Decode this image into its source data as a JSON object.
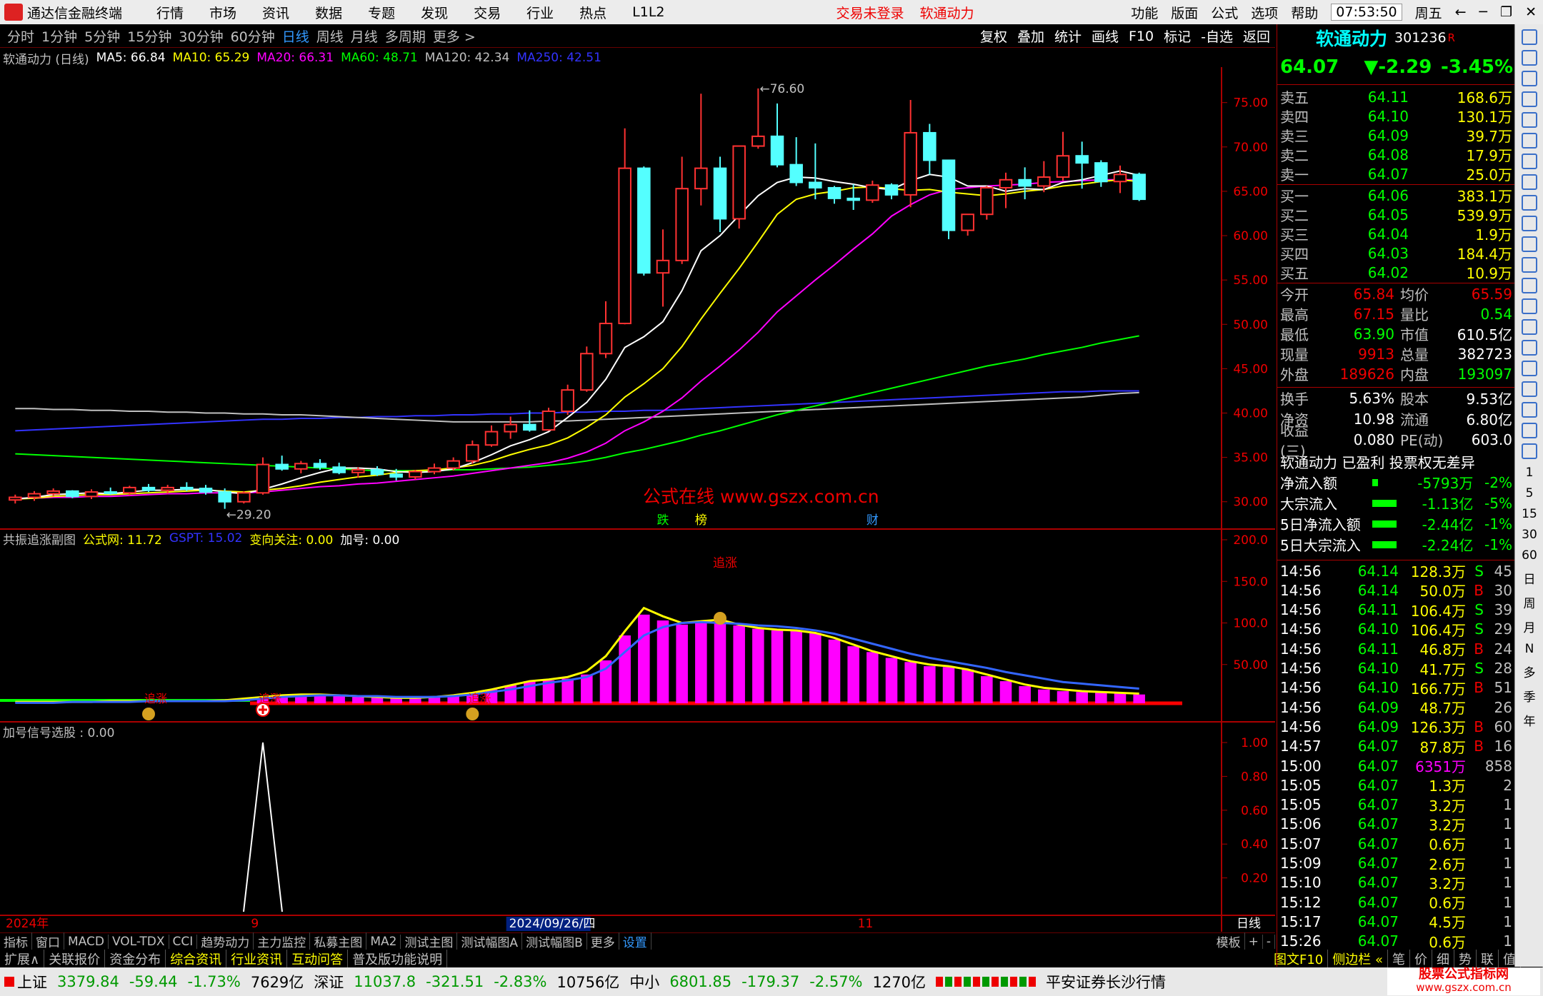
{
  "app": {
    "title": "通达信金融终端",
    "menus": [
      "行情",
      "市场",
      "资讯",
      "数据",
      "专题",
      "发现",
      "交易",
      "行业",
      "热点",
      "L1L2"
    ],
    "warn1": "交易未登录",
    "warn2": "软通动力",
    "rmenus": [
      "功能",
      "版面",
      "公式",
      "选项",
      "帮助"
    ],
    "clock": "07:53:50",
    "weekday": "周五"
  },
  "periods": {
    "items": [
      "分时",
      "1分钟",
      "5分钟",
      "15分钟",
      "30分钟",
      "60分钟",
      "日线",
      "周线",
      "月线",
      "多周期",
      "更多 >"
    ],
    "active": 6,
    "tools": [
      "复权",
      "叠加",
      "统计",
      "画线",
      "F10",
      "标记",
      "-自选",
      "返回"
    ]
  },
  "main": {
    "stock_label": "软通动力 (日线)",
    "ma": [
      {
        "name": "MA5: 66.84",
        "color": "#ffffff"
      },
      {
        "name": "MA10: 65.29",
        "color": "#ffff00"
      },
      {
        "name": "MA20: 66.31",
        "color": "#ff00ff"
      },
      {
        "name": "MA60: 48.71",
        "color": "#00ff00"
      },
      {
        "name": "MA120: 42.34",
        "color": "#c0c0c0"
      },
      {
        "name": "MA250: 42.51",
        "color": "#3333ff"
      }
    ],
    "high_mark": "76.60",
    "low_mark": "29.20",
    "watermark": "公式在线  www.gszx.com.cn",
    "tags": [
      "跌",
      "榜",
      "财"
    ],
    "yticks": [
      "75.00",
      "70.00",
      "65.00",
      "60.00",
      "55.00",
      "50.00",
      "45.00",
      "40.00",
      "35.00",
      "30.00"
    ]
  },
  "sub1": {
    "title": "共振追涨副图",
    "items": [
      "公式网: 11.72",
      "GSPT: 15.02",
      "变向关注: 0.00",
      "加号: 0.00"
    ],
    "label_top": "追涨",
    "label_chase": "追涨",
    "yticks": [
      "200.0",
      "150.0",
      "100.0",
      "50.00"
    ]
  },
  "sub2": {
    "title": "加号信号选股 : 0.00",
    "yticks": [
      "1.00",
      "0.80",
      "0.60",
      "0.40",
      "0.20"
    ]
  },
  "dates": {
    "d1": "2024年",
    "d2": "9",
    "d3": "2024/09/26/四",
    "d4": "11",
    "period": "日线"
  },
  "tabs": [
    "指标",
    "窗口",
    "MACD",
    "VOL-TDX",
    "CCI",
    "趋势动力",
    "主力监控",
    "私募主图",
    "MA2",
    "测试主图",
    "测试幅图A",
    "测试幅图B",
    "更多",
    "设置"
  ],
  "tabs_right": [
    "模板",
    "+",
    "-"
  ],
  "ext": [
    "扩展∧",
    "关联报价",
    "资金分布",
    "综合资讯",
    "行业资讯",
    "互动问答",
    "普及版功能说明"
  ],
  "ext_right": [
    "图文F10",
    "侧边栏 «",
    "笔",
    "价",
    "细",
    "势",
    "联",
    "值",
    "主"
  ],
  "quote": {
    "name": "软通动力",
    "code": "301236",
    "badge": "R",
    "price": "64.07",
    "change": "▼-2.29",
    "pct": "-3.45%"
  },
  "book": {
    "asks": [
      [
        "卖五",
        "64.11",
        "168.6万"
      ],
      [
        "卖四",
        "64.10",
        "130.1万"
      ],
      [
        "卖三",
        "64.09",
        "39.7万"
      ],
      [
        "卖二",
        "64.08",
        "17.9万"
      ],
      [
        "卖一",
        "64.07",
        "25.0万"
      ]
    ],
    "bids": [
      [
        "买一",
        "64.06",
        "383.1万"
      ],
      [
        "买二",
        "64.05",
        "539.9万"
      ],
      [
        "买三",
        "64.04",
        "1.9万"
      ],
      [
        "买四",
        "64.03",
        "184.4万"
      ],
      [
        "买五",
        "64.02",
        "10.9万"
      ]
    ]
  },
  "stats": [
    [
      "今开",
      "65.84",
      "均价",
      "65.59"
    ],
    [
      "最高",
      "67.15",
      "量比",
      "0.54"
    ],
    [
      "最低",
      "63.90",
      "市值",
      "610.5亿"
    ],
    [
      "现量",
      "9913",
      "总量",
      "382723"
    ],
    [
      "外盘",
      "189626",
      "内盘",
      "193097"
    ]
  ],
  "stats2": [
    [
      "换手",
      "5.63%",
      "股本",
      "9.53亿"
    ],
    [
      "净资",
      "10.98",
      "流通",
      "6.80亿"
    ],
    [
      "收益(三)",
      "0.080",
      "PE(动)",
      "603.0"
    ]
  ],
  "info": "软通动力 已盈利 投票权无差异",
  "flows": [
    [
      "净流入额",
      "-5793万",
      "-2%"
    ],
    [
      "大宗流入",
      "-1.13亿",
      "-5%"
    ],
    [
      "5日净流入额",
      "-2.44亿",
      "-1%"
    ],
    [
      "5日大宗流入",
      "-2.24亿",
      "-1%"
    ]
  ],
  "ticks": [
    [
      "14:56",
      "64.14",
      "128.3万",
      "S",
      "45"
    ],
    [
      "14:56",
      "64.14",
      "50.0万",
      "B",
      "30"
    ],
    [
      "14:56",
      "64.11",
      "106.4万",
      "S",
      "39"
    ],
    [
      "14:56",
      "64.10",
      "106.4万",
      "S",
      "29"
    ],
    [
      "14:56",
      "64.11",
      "46.8万",
      "B",
      "24"
    ],
    [
      "14:56",
      "64.10",
      "41.7万",
      "S",
      "28"
    ],
    [
      "14:56",
      "64.10",
      "166.7万",
      "B",
      "51"
    ],
    [
      "14:56",
      "64.09",
      "48.7万",
      "",
      "26"
    ],
    [
      "14:56",
      "64.09",
      "126.3万",
      "B",
      "60"
    ],
    [
      "14:57",
      "64.07",
      "87.8万",
      "B",
      "16"
    ],
    [
      "15:00",
      "64.07",
      "6351万",
      "",
      "858"
    ],
    [
      "15:05",
      "64.07",
      "1.3万",
      "",
      "2"
    ],
    [
      "15:05",
      "64.07",
      "3.2万",
      "",
      "1"
    ],
    [
      "15:06",
      "64.07",
      "3.2万",
      "",
      "1"
    ],
    [
      "15:07",
      "64.07",
      "0.6万",
      "",
      "1"
    ],
    [
      "15:09",
      "64.07",
      "2.6万",
      "",
      "1"
    ],
    [
      "15:10",
      "64.07",
      "3.2万",
      "",
      "1"
    ],
    [
      "15:12",
      "64.07",
      "0.6万",
      "",
      "1"
    ],
    [
      "15:17",
      "64.07",
      "4.5万",
      "",
      "1"
    ],
    [
      "15:26",
      "64.07",
      "0.6万",
      "",
      "1"
    ]
  ],
  "sidebar": [
    "1",
    "5",
    "15",
    "30",
    "60",
    "日",
    "周",
    "月",
    "N",
    "多",
    "季",
    "年"
  ],
  "status": {
    "sh": "上证",
    "sh_v": "3379.84",
    "sh_c": "-59.44",
    "sh_p": "-1.73%",
    "sh_a": "7629亿",
    "sz": "深证",
    "sz_v": "11037.8",
    "sz_c": "-321.51",
    "sz_p": "-2.83%",
    "sz_a": "10756亿",
    "zx": "中小",
    "zx_v": "6801.85",
    "zx_c": "-179.37",
    "zx_p": "-2.57%",
    "zx_a": "1270亿",
    "broker": "平安证券长沙行情",
    "site": "股票公式指标网",
    "site_url": "www.gszx.com.cn"
  },
  "chart_data": {
    "type": "candlestick",
    "ohlc": [
      [
        30.2,
        30.8,
        29.8,
        30.5
      ],
      [
        30.5,
        31.2,
        30.1,
        30.9
      ],
      [
        30.9,
        31.5,
        30.6,
        31.2
      ],
      [
        31.2,
        31.3,
        30.4,
        30.6
      ],
      [
        30.6,
        31.4,
        30.3,
        31.1
      ],
      [
        31.1,
        31.6,
        30.8,
        31.0
      ],
      [
        31.0,
        31.8,
        30.7,
        31.6
      ],
      [
        31.6,
        32.0,
        31.1,
        31.3
      ],
      [
        31.3,
        31.9,
        30.9,
        31.6
      ],
      [
        31.6,
        32.2,
        31.2,
        31.5
      ],
      [
        31.5,
        31.9,
        30.8,
        31.1
      ],
      [
        31.1,
        31.5,
        29.2,
        30.0
      ],
      [
        30.0,
        31.2,
        29.8,
        31.0
      ],
      [
        31.0,
        35.0,
        30.8,
        34.2
      ],
      [
        34.2,
        35.2,
        33.5,
        33.7
      ],
      [
        33.7,
        34.6,
        33.2,
        34.3
      ],
      [
        34.3,
        34.8,
        33.6,
        33.9
      ],
      [
        33.9,
        34.4,
        33.1,
        33.3
      ],
      [
        33.3,
        33.9,
        32.7,
        33.6
      ],
      [
        33.6,
        34.0,
        32.9,
        33.1
      ],
      [
        33.1,
        33.7,
        32.4,
        32.8
      ],
      [
        32.8,
        33.6,
        32.5,
        33.4
      ],
      [
        33.4,
        34.3,
        33.1,
        33.8
      ],
      [
        33.8,
        35.0,
        33.5,
        34.6
      ],
      [
        34.6,
        36.9,
        34.3,
        36.4
      ],
      [
        36.4,
        38.6,
        36.2,
        37.9
      ],
      [
        37.9,
        39.6,
        37.1,
        38.7
      ],
      [
        38.7,
        40.3,
        37.9,
        38.1
      ],
      [
        38.1,
        40.6,
        38.0,
        40.2
      ],
      [
        40.2,
        43.2,
        39.8,
        42.6
      ],
      [
        42.6,
        47.5,
        42.4,
        46.7
      ],
      [
        46.7,
        52.6,
        46.2,
        50.1
      ],
      [
        50.1,
        72.1,
        50.0,
        67.6
      ],
      [
        67.6,
        67.8,
        55.5,
        55.8
      ],
      [
        55.8,
        60.7,
        52.0,
        57.2
      ],
      [
        57.2,
        68.9,
        56.8,
        65.3
      ],
      [
        65.3,
        76.0,
        63.4,
        67.6
      ],
      [
        67.6,
        68.9,
        60.4,
        61.9
      ],
      [
        61.9,
        69.2,
        60.8,
        70.1
      ],
      [
        70.1,
        76.6,
        69.8,
        71.2
      ],
      [
        71.2,
        74.9,
        67.7,
        68.0
      ],
      [
        68.0,
        71.1,
        65.6,
        66.0
      ],
      [
        66.0,
        70.4,
        64.1,
        65.4
      ],
      [
        65.4,
        65.6,
        63.6,
        64.2
      ],
      [
        64.2,
        65.8,
        62.9,
        64.0
      ],
      [
        64.0,
        66.2,
        63.7,
        65.7
      ],
      [
        65.7,
        65.9,
        64.1,
        64.6
      ],
      [
        64.6,
        75.3,
        63.2,
        71.6
      ],
      [
        71.6,
        72.6,
        66.9,
        68.5
      ],
      [
        68.5,
        67.3,
        59.6,
        60.6
      ],
      [
        60.6,
        62.1,
        60.0,
        62.4
      ],
      [
        62.4,
        65.6,
        61.8,
        65.4
      ],
      [
        65.4,
        67.1,
        63.1,
        66.3
      ],
      [
        66.3,
        67.7,
        64.1,
        65.6
      ],
      [
        65.6,
        68.4,
        64.9,
        66.6
      ],
      [
        66.6,
        71.7,
        66.2,
        69.0
      ],
      [
        69.0,
        70.6,
        65.3,
        68.2
      ],
      [
        68.2,
        68.5,
        65.5,
        66.1
      ],
      [
        66.1,
        67.9,
        64.8,
        66.9
      ],
      [
        66.9,
        67.1,
        63.9,
        64.1
      ]
    ],
    "ma5": [
      30.3,
      30.5,
      30.8,
      30.9,
      31.0,
      30.9,
      31.1,
      31.3,
      31.3,
      31.4,
      31.4,
      31.1,
      30.9,
      31.4,
      32.0,
      32.7,
      33.3,
      33.8,
      33.8,
      33.7,
      33.4,
      33.3,
      33.4,
      33.7,
      34.4,
      35.3,
      36.3,
      37.0,
      37.9,
      39.5,
      41.2,
      43.8,
      47.4,
      48.6,
      50.3,
      53.8,
      58.3,
      60.0,
      62.3,
      64.5,
      66.0,
      66.6,
      66.5,
      66.1,
      65.8,
      65.4,
      65.2,
      66.2,
      66.9,
      66.6,
      65.6,
      65.6,
      65.0,
      65.3,
      65.2,
      66.0,
      66.3,
      66.8,
      67.3,
      66.8
    ],
    "ma10": [
      30.3,
      30.4,
      30.6,
      30.7,
      30.8,
      30.8,
      30.9,
      31.0,
      31.1,
      31.2,
      31.3,
      31.2,
      31.1,
      31.3,
      31.5,
      31.8,
      32.2,
      32.5,
      32.8,
      33.0,
      33.3,
      33.5,
      33.6,
      33.8,
      34.1,
      34.6,
      35.3,
      35.9,
      36.4,
      37.2,
      38.4,
      39.8,
      41.8,
      43.3,
      45.0,
      47.5,
      50.6,
      53.5,
      56.3,
      59.3,
      62.4,
      64.1,
      64.7,
      65.0,
      65.4,
      65.5,
      65.3,
      65.1,
      65.2,
      64.9,
      64.7,
      64.5,
      64.7,
      65.0,
      65.2,
      65.6,
      65.8,
      66.1,
      66.3,
      66.1
    ],
    "ma20": [
      30.4,
      30.4,
      30.5,
      30.5,
      30.6,
      30.6,
      30.7,
      30.8,
      30.9,
      30.9,
      31.0,
      31.0,
      31.0,
      31.1,
      31.3,
      31.5,
      31.7,
      31.8,
      32.0,
      32.1,
      32.3,
      32.5,
      32.7,
      32.9,
      33.2,
      33.5,
      33.8,
      34.1,
      34.4,
      34.9,
      35.6,
      36.6,
      38.0,
      39.0,
      40.2,
      41.7,
      43.6,
      45.3,
      47.1,
      49.1,
      51.4,
      53.2,
      55.0,
      56.7,
      58.5,
      60.2,
      62.2,
      63.5,
      64.6,
      65.2,
      65.4,
      65.6,
      65.7,
      65.8,
      66.0,
      66.1,
      66.2,
      66.3,
      66.3,
      66.3
    ],
    "ma60": [
      35.4,
      35.3,
      35.2,
      35.1,
      35.0,
      34.9,
      34.8,
      34.7,
      34.6,
      34.5,
      34.4,
      34.3,
      34.2,
      34.1,
      34.0,
      33.9,
      33.8,
      33.7,
      33.6,
      33.5,
      33.5,
      33.5,
      33.5,
      33.6,
      33.6,
      33.7,
      33.8,
      33.9,
      34.1,
      34.3,
      34.6,
      35.0,
      35.5,
      35.9,
      36.4,
      36.9,
      37.5,
      38.0,
      38.6,
      39.2,
      39.8,
      40.3,
      40.8,
      41.3,
      41.8,
      42.3,
      42.8,
      43.3,
      43.8,
      44.3,
      44.8,
      45.3,
      45.7,
      46.1,
      46.6,
      47.0,
      47.4,
      47.9,
      48.3,
      48.7
    ],
    "ma120": [
      40.5,
      40.5,
      40.4,
      40.4,
      40.3,
      40.3,
      40.2,
      40.2,
      40.1,
      40.1,
      40.0,
      40.0,
      39.9,
      39.9,
      39.8,
      39.8,
      39.7,
      39.6,
      39.5,
      39.4,
      39.3,
      39.2,
      39.1,
      39.0,
      39.0,
      39.0,
      39.0,
      39.0,
      39.1,
      39.1,
      39.2,
      39.3,
      39.4,
      39.5,
      39.6,
      39.7,
      39.8,
      39.9,
      40.0,
      40.1,
      40.2,
      40.3,
      40.4,
      40.5,
      40.6,
      40.7,
      40.8,
      40.9,
      41.0,
      41.1,
      41.2,
      41.3,
      41.4,
      41.5,
      41.6,
      41.7,
      41.8,
      42.0,
      42.2,
      42.3
    ],
    "ma250": [
      38.0,
      38.1,
      38.2,
      38.3,
      38.4,
      38.5,
      38.6,
      38.7,
      38.8,
      38.9,
      39.0,
      39.1,
      39.2,
      39.3,
      39.3,
      39.4,
      39.4,
      39.5,
      39.5,
      39.6,
      39.6,
      39.7,
      39.7,
      39.8,
      39.8,
      39.9,
      39.9,
      40.0,
      40.0,
      40.1,
      40.1,
      40.2,
      40.2,
      40.3,
      40.3,
      40.4,
      40.5,
      40.6,
      40.7,
      40.8,
      40.9,
      41.0,
      41.1,
      41.2,
      41.3,
      41.4,
      41.5,
      41.6,
      41.7,
      41.8,
      41.9,
      42.0,
      42.1,
      42.2,
      42.3,
      42.4,
      42.4,
      42.5,
      42.5,
      42.5
    ],
    "sub_bars": [
      4,
      4,
      4,
      5,
      5,
      5,
      5,
      6,
      6,
      6,
      6,
      6,
      7,
      10,
      13,
      14,
      14,
      13,
      11,
      11,
      10,
      10,
      11,
      13,
      16,
      20,
      25,
      30,
      31,
      33,
      38,
      55,
      85,
      110,
      103,
      98,
      100,
      104,
      97,
      93,
      91,
      91,
      88,
      80,
      72,
      65,
      58,
      53,
      48,
      47,
      44,
      36,
      30,
      24,
      20,
      18,
      17,
      16,
      15,
      14
    ],
    "sub_yellow": [
      5,
      5,
      5,
      5,
      5,
      6,
      6,
      6,
      6,
      6,
      6,
      7,
      9,
      11,
      13,
      14,
      14,
      13,
      12,
      11,
      10,
      10,
      11,
      13,
      16,
      20,
      25,
      30,
      32,
      35,
      42,
      60,
      90,
      118,
      108,
      100,
      102,
      104,
      98,
      94,
      92,
      91,
      88,
      82,
      74,
      66,
      60,
      54,
      50,
      48,
      44,
      38,
      32,
      26,
      22,
      20,
      18,
      17,
      16,
      15
    ],
    "sub_blue": [
      4,
      4,
      4,
      5,
      5,
      5,
      5,
      6,
      6,
      6,
      6,
      6,
      7,
      9,
      11,
      12,
      13,
      13,
      12,
      12,
      11,
      11,
      11,
      12,
      14,
      17,
      20,
      24,
      28,
      31,
      35,
      45,
      65,
      85,
      95,
      100,
      101,
      100,
      99,
      97,
      96,
      94,
      91,
      87,
      81,
      75,
      69,
      63,
      58,
      54,
      50,
      46,
      41,
      37,
      33,
      29,
      27,
      25,
      23,
      21
    ],
    "signal_x": "2024-08-27",
    "ylim": [
      27,
      79
    ]
  }
}
